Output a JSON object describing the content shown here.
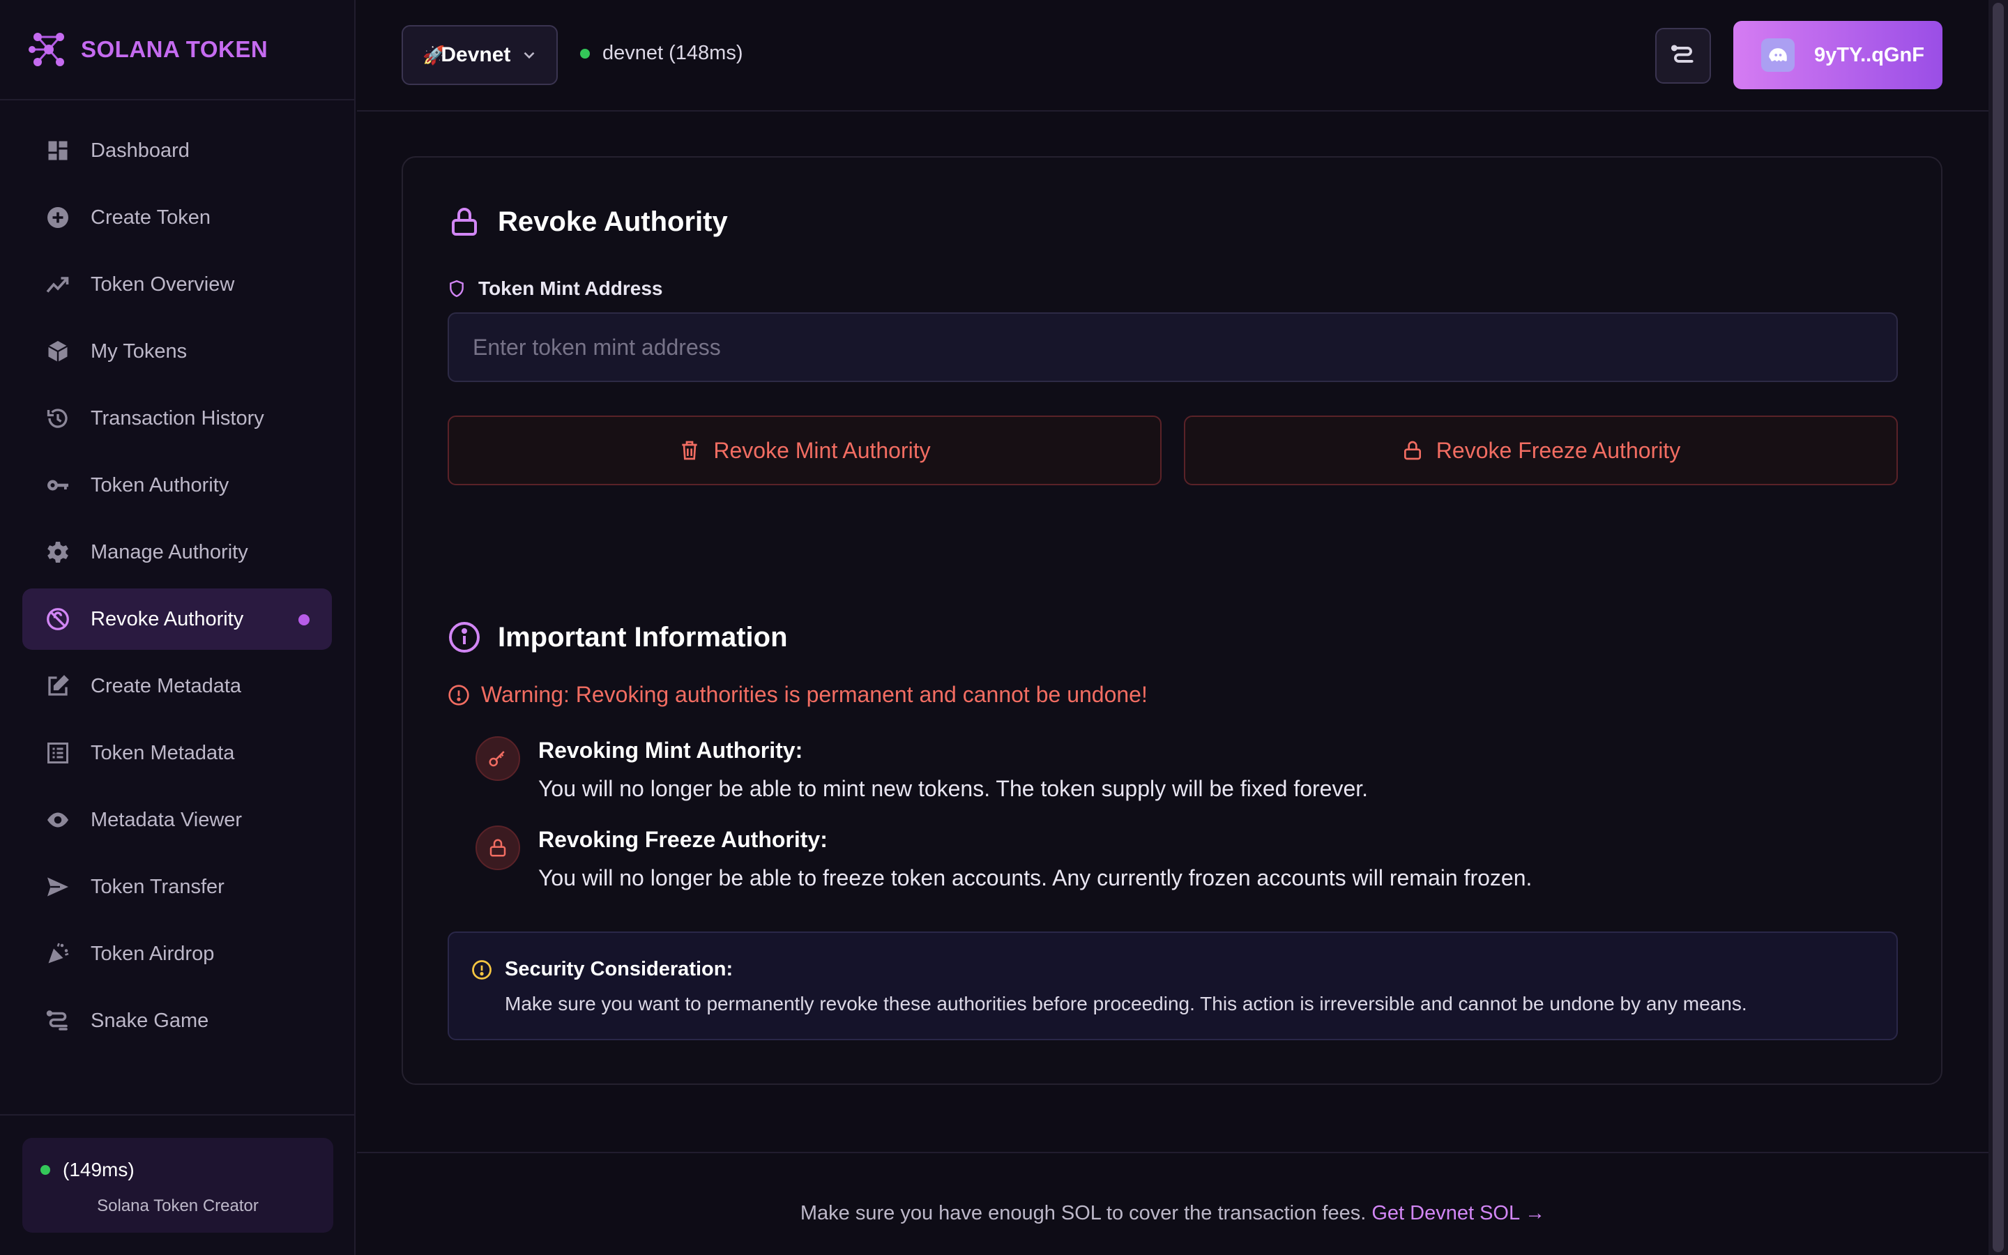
{
  "brand": {
    "title": "SOLANA TOKEN"
  },
  "sidebar": {
    "items": [
      {
        "label": "Dashboard",
        "icon": "dashboard-icon"
      },
      {
        "label": "Create Token",
        "icon": "plus-circle-icon"
      },
      {
        "label": "Token Overview",
        "icon": "trend-icon"
      },
      {
        "label": "My Tokens",
        "icon": "cubes-icon"
      },
      {
        "label": "Transaction History",
        "icon": "history-icon"
      },
      {
        "label": "Token Authority",
        "icon": "key-icon"
      },
      {
        "label": "Manage Authority",
        "icon": "gear-icon"
      },
      {
        "label": "Revoke Authority",
        "icon": "revoke-icon",
        "active": true
      },
      {
        "label": "Create Metadata",
        "icon": "edit-icon"
      },
      {
        "label": "Token Metadata",
        "icon": "list-icon"
      },
      {
        "label": "Metadata Viewer",
        "icon": "eye-icon"
      },
      {
        "label": "Token Transfer",
        "icon": "send-icon"
      },
      {
        "label": "Token Airdrop",
        "icon": "party-icon"
      },
      {
        "label": "Snake Game",
        "icon": "snake-icon"
      }
    ],
    "status": {
      "latency": "(149ms)",
      "subtitle": "Solana Token Creator"
    }
  },
  "header": {
    "network_select": "Devnet",
    "network_status": "devnet (148ms)",
    "wallet_address": "9yTY..qGnF"
  },
  "card": {
    "title": "Revoke Authority",
    "field_label": "Token Mint Address",
    "field_placeholder": "Enter token mint address",
    "field_value": "",
    "revoke_mint_label": "Revoke Mint Authority",
    "revoke_freeze_label": "Revoke Freeze Authority",
    "info_title": "Important Information",
    "warning": "Warning: Revoking authorities is permanent and cannot be undone!",
    "mint_item": {
      "heading": "Revoking Mint Authority:",
      "body": "You will no longer be able to mint new tokens. The token supply will be fixed forever."
    },
    "freeze_item": {
      "heading": "Revoking Freeze Authority:",
      "body": "You will no longer be able to freeze token accounts. Any currently frozen accounts will remain frozen."
    },
    "security": {
      "heading": "Security Consideration:",
      "body": "Make sure you want to permanently revoke these authorities before proceeding. This action is irreversible and cannot be undone by any means."
    }
  },
  "footer": {
    "text": "Make sure you have enough SOL to cover the transaction fees.",
    "link": "Get Devnet SOL →"
  },
  "colors": {
    "accent": "#d286f5",
    "danger": "#f26d62",
    "warning": "#f5c542",
    "online": "#34c759",
    "background": "#0e0c16"
  }
}
